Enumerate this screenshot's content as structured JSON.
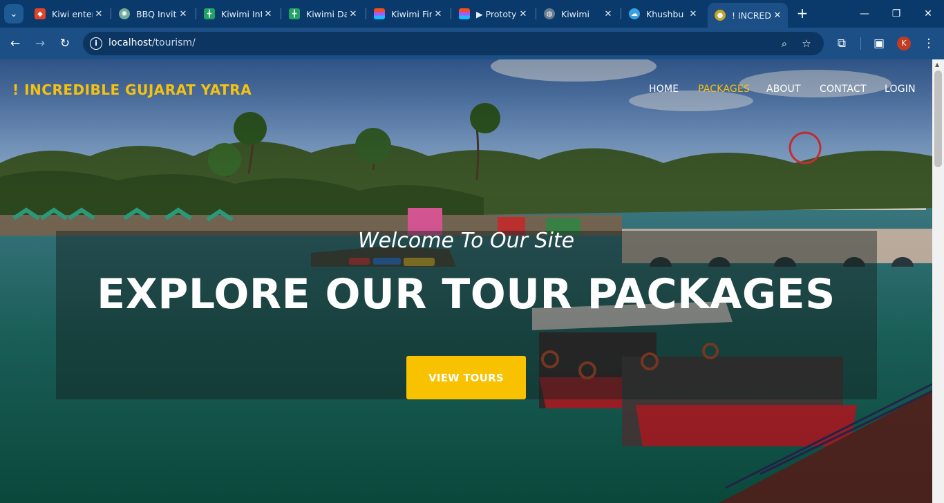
{
  "browser": {
    "tabs": [
      {
        "title": "Kiwi enter",
        "icon": "gitlab-icon",
        "color": "#e24329"
      },
      {
        "title": "BBQ Invit",
        "icon": "chatgpt-icon",
        "color": "#74aa9c"
      },
      {
        "title": "Kiwimi Int",
        "icon": "sheets-icon",
        "color": "#1fa463"
      },
      {
        "title": "Kiwimi Da",
        "icon": "sheets-icon",
        "color": "#1fa463"
      },
      {
        "title": "Kiwimi Fir",
        "icon": "figma-icon",
        "color": "#f24e1e"
      },
      {
        "title": "▶ Prototy",
        "icon": "figma-icon",
        "color": "#a259ff"
      },
      {
        "title": "Kiwimi",
        "icon": "globe-icon",
        "color": "#6b7c8f"
      },
      {
        "title": "Khushbu I",
        "icon": "cloud-icon",
        "color": "#3aa0e0"
      },
      {
        "title": "! INCREDI",
        "icon": "site-icon",
        "color": "#c9a227"
      }
    ],
    "new_tab": "+",
    "url_host": "localhost",
    "url_path": "/tourism/",
    "profile_initial": "K"
  },
  "site": {
    "brand": "! INCREDIBLE GUJARAT YATRA",
    "nav": [
      {
        "label": "HOME"
      },
      {
        "label": "PACKAGES"
      },
      {
        "label": "ABOUT"
      },
      {
        "label": "CONTACT"
      },
      {
        "label": "LOGIN"
      }
    ],
    "active_nav": "PACKAGES",
    "accent": "#f5c211"
  },
  "hero": {
    "welcome": "Welcome To Our Site",
    "headline": "EXPLORE OUR TOUR PACKAGES",
    "cta_label": "VIEW TOURS",
    "cta_color": "#f8c200"
  }
}
